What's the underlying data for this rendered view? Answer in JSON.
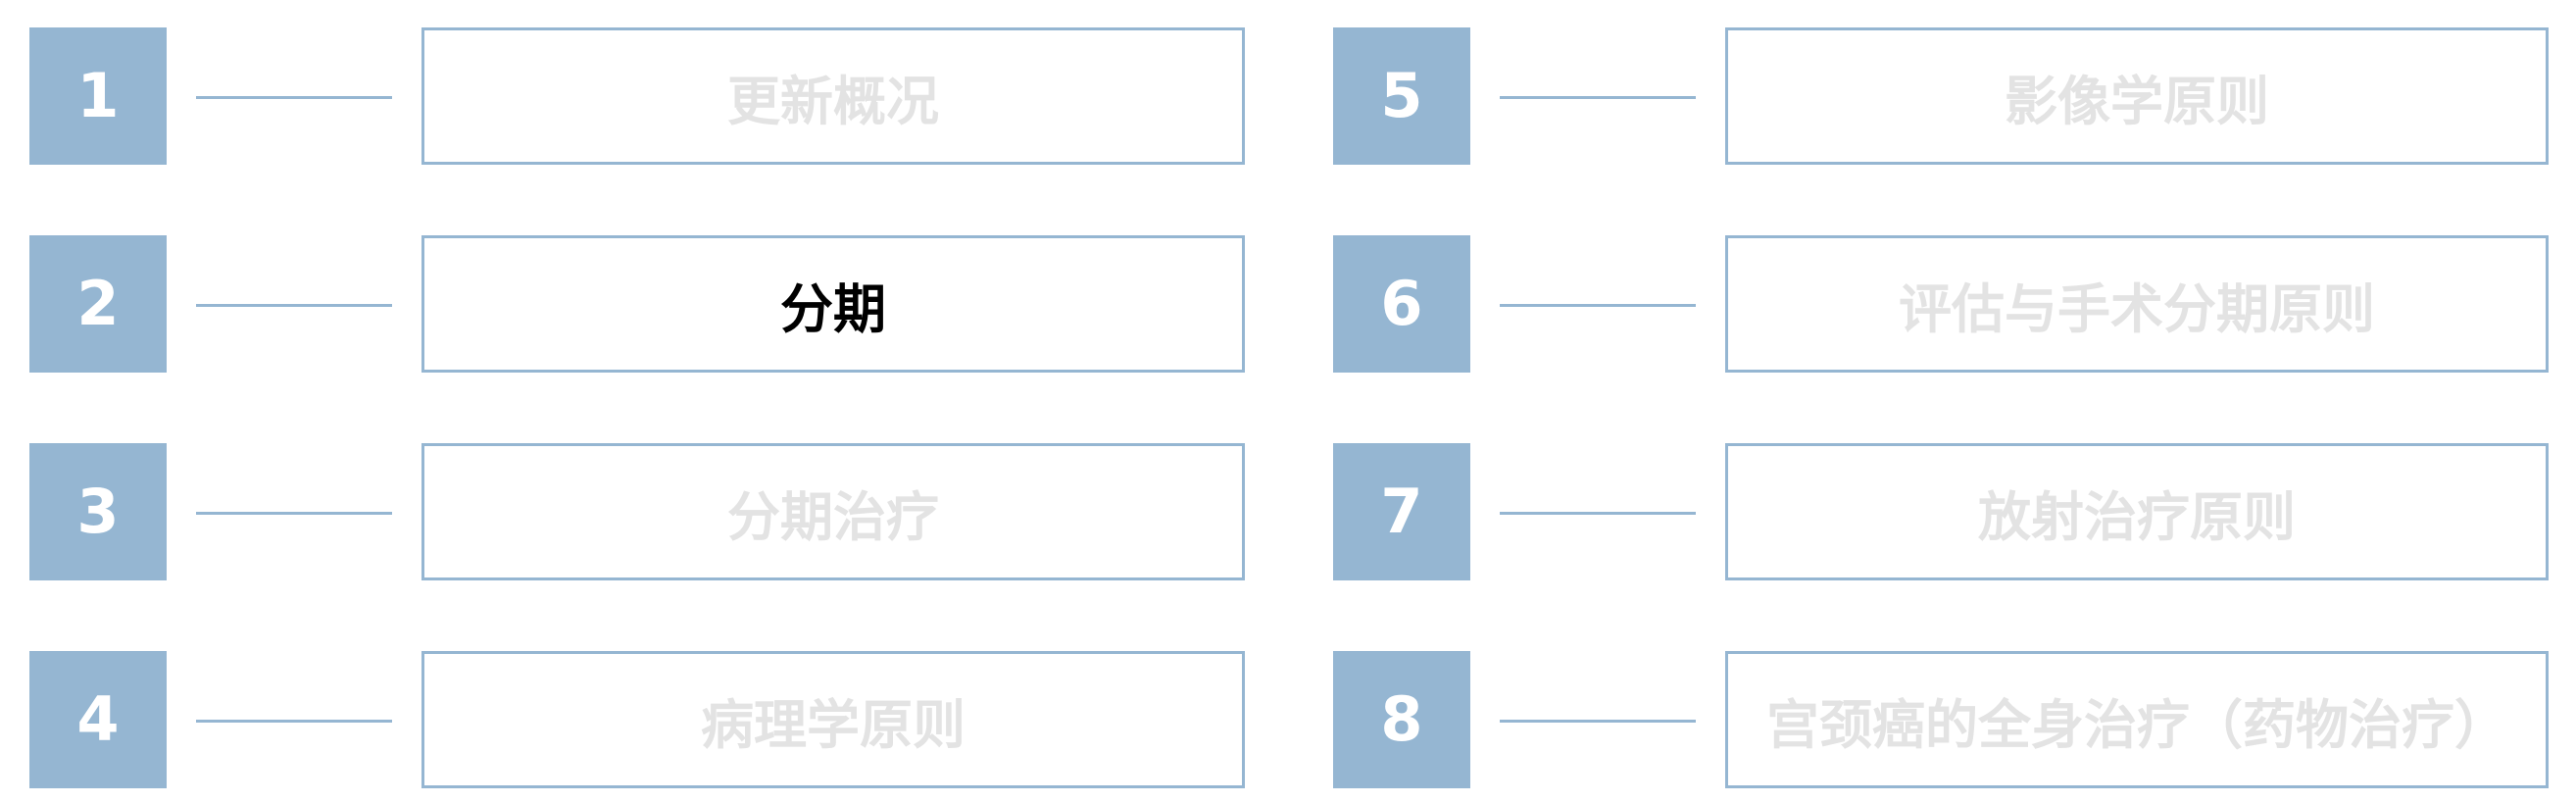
{
  "colors": {
    "accent": "#95b6d2",
    "number_text": "#ffffff",
    "inactive_text": "#e3e3e3",
    "active_text": "#000000"
  },
  "menu": {
    "items": [
      {
        "number": "1",
        "label": "更新概况",
        "active": false
      },
      {
        "number": "2",
        "label": "分期",
        "active": true
      },
      {
        "number": "3",
        "label": "分期治疗",
        "active": false
      },
      {
        "number": "4",
        "label": "病理学原则",
        "active": false
      },
      {
        "number": "5",
        "label": "影像学原则",
        "active": false
      },
      {
        "number": "6",
        "label": "评估与手术分期原则",
        "active": false
      },
      {
        "number": "7",
        "label": "放射治疗原则",
        "active": false
      },
      {
        "number": "8",
        "label": "宫颈癌的全身治疗（药物治疗）",
        "active": false
      }
    ]
  }
}
